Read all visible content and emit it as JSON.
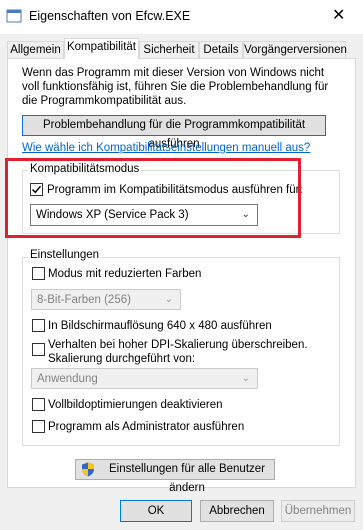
{
  "window": {
    "title": "Eigenschaften von Efcw.EXE",
    "close_symbol": "✕"
  },
  "tabs": [
    {
      "label": "Allgemein"
    },
    {
      "label": "Kompatibilität"
    },
    {
      "label": "Sicherheit"
    },
    {
      "label": "Details"
    },
    {
      "label": "Vorgängerversionen"
    }
  ],
  "compat": {
    "intro": "Wenn das Programm mit dieser Version von Windows nicht voll funktionsfähig ist, führen Sie die Problembehandlung für die Programmkompatibilität aus.",
    "troubleshoot_button": "Problembehandlung für die Programmkompatibilität ausführen",
    "manual_link": "Wie wähle ich Kompatibilitätseinstellungen manuell aus?",
    "mode_group": {
      "label": "Kompatibilitätsmodus",
      "checkbox_label": "Programm im Kompatibilitätsmodus ausführen für:",
      "checked": true,
      "selected_os": "Windows XP (Service Pack 3)"
    },
    "settings_group": {
      "label": "Einstellungen",
      "reduced_color": {
        "label": "Modus mit reduzierten Farben",
        "checked": false
      },
      "color_select": "8-Bit-Farben (256)",
      "res640": {
        "label": "In Bildschirmauflösung 640 x 480 ausführen",
        "checked": false
      },
      "dpi": {
        "label": "Verhalten bei hoher DPI-Skalierung überschreiben. Skalierung durchgeführt von:",
        "checked": false
      },
      "dpi_select": "Anwendung",
      "fullscreen": {
        "label": "Vollbildoptimierungen deaktivieren",
        "checked": false
      },
      "admin": {
        "label": "Programm als Administrator ausführen",
        "checked": false
      }
    },
    "all_users_button": "Einstellungen für alle Benutzer ändern"
  },
  "footer": {
    "ok": "OK",
    "cancel": "Abbrechen",
    "apply": "Übernehmen"
  },
  "colors": {
    "highlight_box": "#e02030",
    "link": "#0066cc",
    "focus": "#0078d7"
  }
}
